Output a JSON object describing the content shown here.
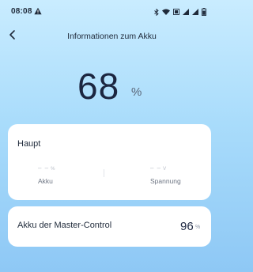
{
  "status_bar": {
    "time": "08:08",
    "icons": [
      "warning-icon",
      "bluetooth-icon",
      "wifi-icon",
      "sim-icon",
      "signal-icon",
      "signal-icon",
      "battery-icon"
    ]
  },
  "header": {
    "title": "Informationen zum Akku",
    "back_icon": "chevron-left-icon"
  },
  "battery": {
    "value": "68",
    "unit": "%"
  },
  "main_card": {
    "title": "Haupt",
    "akku": {
      "value": "– –",
      "unit": "%",
      "label": "Akku"
    },
    "spannung": {
      "value": "– –",
      "unit": "V",
      "label": "Spannung"
    }
  },
  "master_card": {
    "label": "Akku der Master-Control",
    "value": "96",
    "unit": "%"
  },
  "colors": {
    "background_top": "#c9ecff",
    "background_bottom": "#8ec8f5",
    "card": "#ffffff",
    "text_primary": "#1c2640",
    "text_secondary": "#6e7684",
    "placeholder": "#b7bcc6"
  }
}
